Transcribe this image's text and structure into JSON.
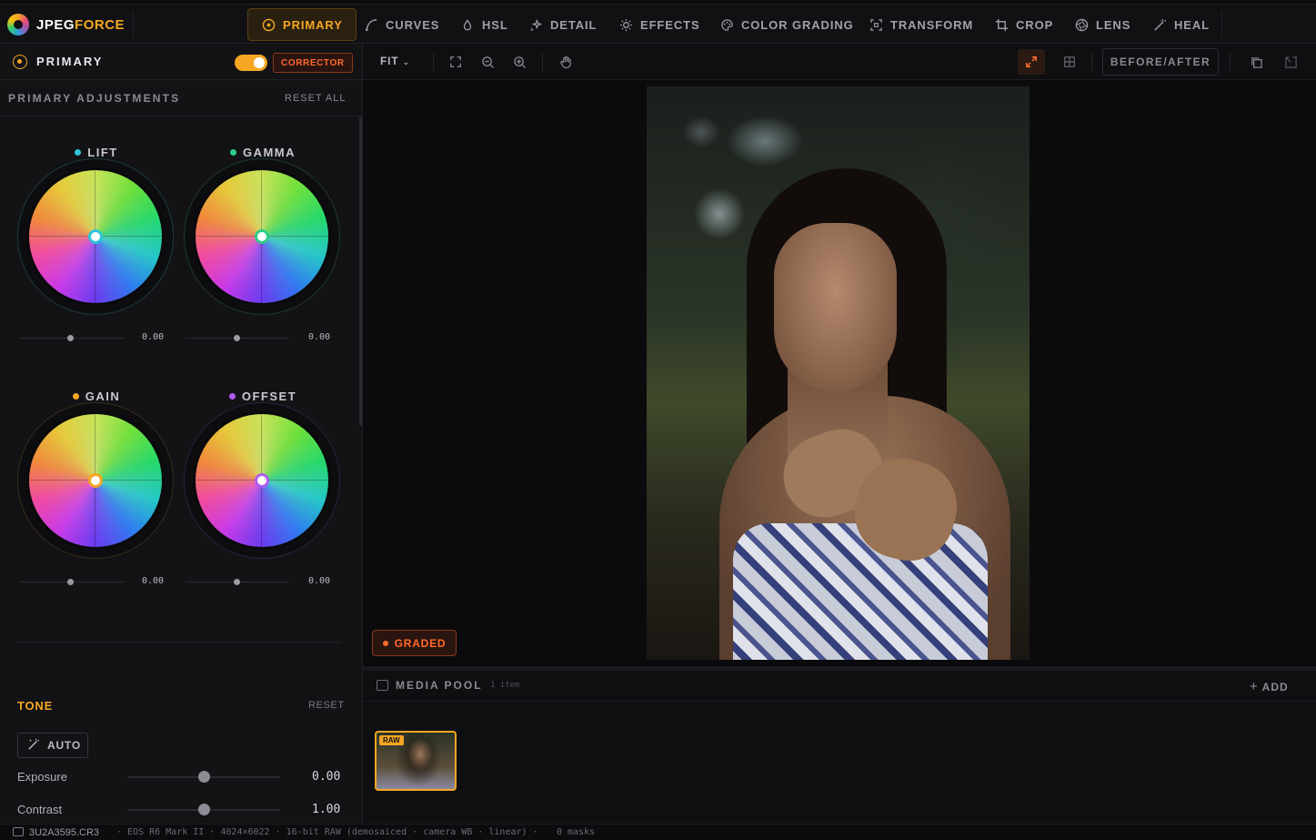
{
  "app": {
    "brand_prefix": "JPEG",
    "brand_suffix": "FORCE"
  },
  "tabs": [
    {
      "label": "PRIMARY",
      "icon": "target-icon",
      "active": true
    },
    {
      "label": "CURVES",
      "icon": "curve-icon"
    },
    {
      "label": "HSL",
      "icon": "droplet-icon"
    },
    {
      "label": "DETAIL",
      "icon": "sparkle-icon"
    },
    {
      "label": "EFFECTS",
      "icon": "sun-icon"
    },
    {
      "label": "COLOR GRADING",
      "icon": "palette-icon"
    },
    {
      "label": "TRANSFORM",
      "icon": "frame-icon"
    },
    {
      "label": "CROP",
      "icon": "crop-icon"
    },
    {
      "label": "LENS",
      "icon": "aperture-icon"
    },
    {
      "label": "HEAL",
      "icon": "wand-icon"
    }
  ],
  "panel": {
    "title": "PRIMARY",
    "mode_badge": "CORRECTOR",
    "section_title": "PRIMARY ADJUSTMENTS",
    "reset_all": "RESET ALL",
    "enabled": true
  },
  "wheels": [
    {
      "label": "LIFT",
      "dot_color": "#2ec4d8",
      "value": "0.00"
    },
    {
      "label": "GAMMA",
      "dot_color": "#2ecc8a",
      "value": "0.00"
    },
    {
      "label": "GAIN",
      "dot_color": "#f5a623",
      "value": "0.00"
    },
    {
      "label": "OFFSET",
      "dot_color": "#b05cf0",
      "value": "0.00"
    }
  ],
  "tone": {
    "title": "TONE",
    "reset": "RESET",
    "auto": "AUTO",
    "rows": [
      {
        "label": "Exposure",
        "value": "0.00"
      },
      {
        "label": "Contrast",
        "value": "1.00"
      }
    ]
  },
  "viewer": {
    "fit": "FIT",
    "before_after": "BEFORE/AFTER",
    "graded_badge": "GRADED"
  },
  "media_pool": {
    "title": "MEDIA POOL",
    "count": "1 item",
    "add": "ADD",
    "thumb_badge": "RAW"
  },
  "status": {
    "file": "3U2A3595.CR3",
    "meta": "·   EOS R6 Mark II · 4024×6022 · 16-bit RAW (demosaiced · camera WB · linear)   ·",
    "masks": "0 masks"
  },
  "colors": {
    "accent": "#f5a623",
    "accent_red": "#ff6a2a"
  }
}
